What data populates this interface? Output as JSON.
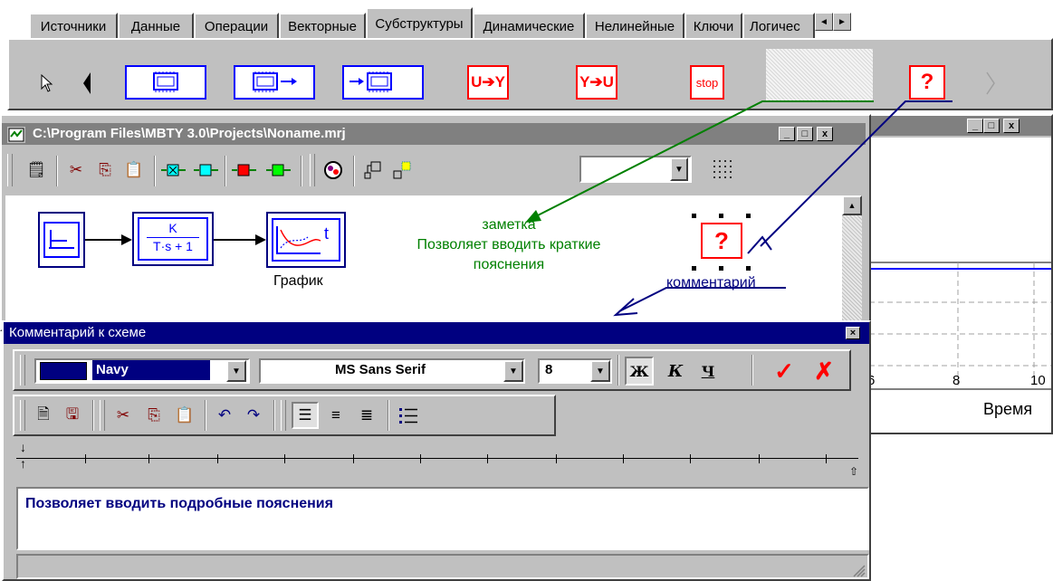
{
  "palette": {
    "tabs": [
      "Источники",
      "Данные",
      "Операции",
      "Векторные",
      "Субструктуры",
      "Динамические",
      "Нелинейные",
      "Ключи",
      "Логичес"
    ],
    "active_tab": "Субструктуры",
    "scroll_left": "◄",
    "scroll_right": "►",
    "blocks": [
      "U➔Y",
      "Y➔U",
      "stop",
      "?"
    ]
  },
  "project_window": {
    "title": "C:\\Program Files\\MBTY 3.0\\Projects\\Noname.mrj",
    "min": "_",
    "max": "□",
    "close": "x",
    "transfer_numerator": "K",
    "transfer_denominator": "T·s + 1",
    "graph_label": "График",
    "note_text_1": "заметка",
    "note_text_2": "Позволяет вводить краткие",
    "note_text_3": "пояснения",
    "comment_label": "комментарий",
    "comment_symbol": "?"
  },
  "graph_window": {
    "min": "_",
    "max": "□",
    "close": "x",
    "tick_labels": [
      "6",
      "8",
      "10"
    ],
    "xlabel": "Время"
  },
  "comment_dialog": {
    "title": "Комментарий к схеме",
    "close": "×",
    "color_value": "Navy",
    "font_value": "MS Sans Serif",
    "size_value": "8",
    "bold": "Ж",
    "italic": "К",
    "underline": "Ч",
    "ok": "✓",
    "cancel": "✗",
    "body_text": "Позволяет вводить подробные пояснения",
    "colors": {
      "navy": "#000080",
      "caption": "#000080"
    }
  }
}
